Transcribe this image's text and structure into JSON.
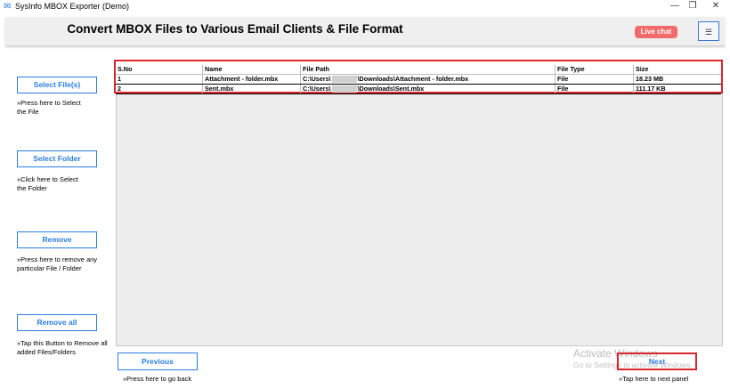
{
  "window": {
    "title": "SysInfo MBOX Exporter (Demo)",
    "icon": "app-logo-icon",
    "controls": {
      "minimize": "—",
      "maximize": "❐",
      "close": "✕"
    }
  },
  "header": {
    "title": "Convert MBOX Files to Various Email Clients & File Format",
    "live_chat": "Live chat",
    "menu": "☰"
  },
  "sidebar": {
    "select_files": {
      "label": "Select File(s)",
      "hint": "»Press here to Select the File"
    },
    "select_folder": {
      "label": "Select Folder",
      "hint": "»Click here to Select the Folder"
    },
    "remove": {
      "label": "Remove",
      "hint": "»Press here to remove any particular File / Folder"
    },
    "remove_all": {
      "label": "Remove all",
      "hint": "»Tap this Button to Remove all added Files/Folders"
    }
  },
  "table": {
    "columns": [
      "S.No",
      "Name",
      "File Path",
      "File Type",
      "Size"
    ],
    "rows": [
      {
        "sno": "1",
        "name": "Attachment - folder.mbx",
        "path_a": "C:\\Users\\",
        "path_b": "\\Downloads\\Attachment - folder.mbx",
        "type": "File",
        "size": "18.23 MB"
      },
      {
        "sno": "2",
        "name": "Sent.mbx",
        "path_a": "C:\\Users\\",
        "path_b": "\\Downloads\\Sent.mbx",
        "type": "File",
        "size": "111.17 KB"
      }
    ]
  },
  "footer": {
    "previous": "Previous",
    "previous_hint": "»Press here to go back",
    "next": "Next",
    "next_hint": "»Tap here to next panel"
  },
  "watermark": {
    "line1": "Activate Windows",
    "line2": "Go to Settings to activate Windows."
  },
  "colors": {
    "accent": "#2a7de1",
    "highlight": "#d9262f",
    "live_chat": "#f26b6b"
  }
}
